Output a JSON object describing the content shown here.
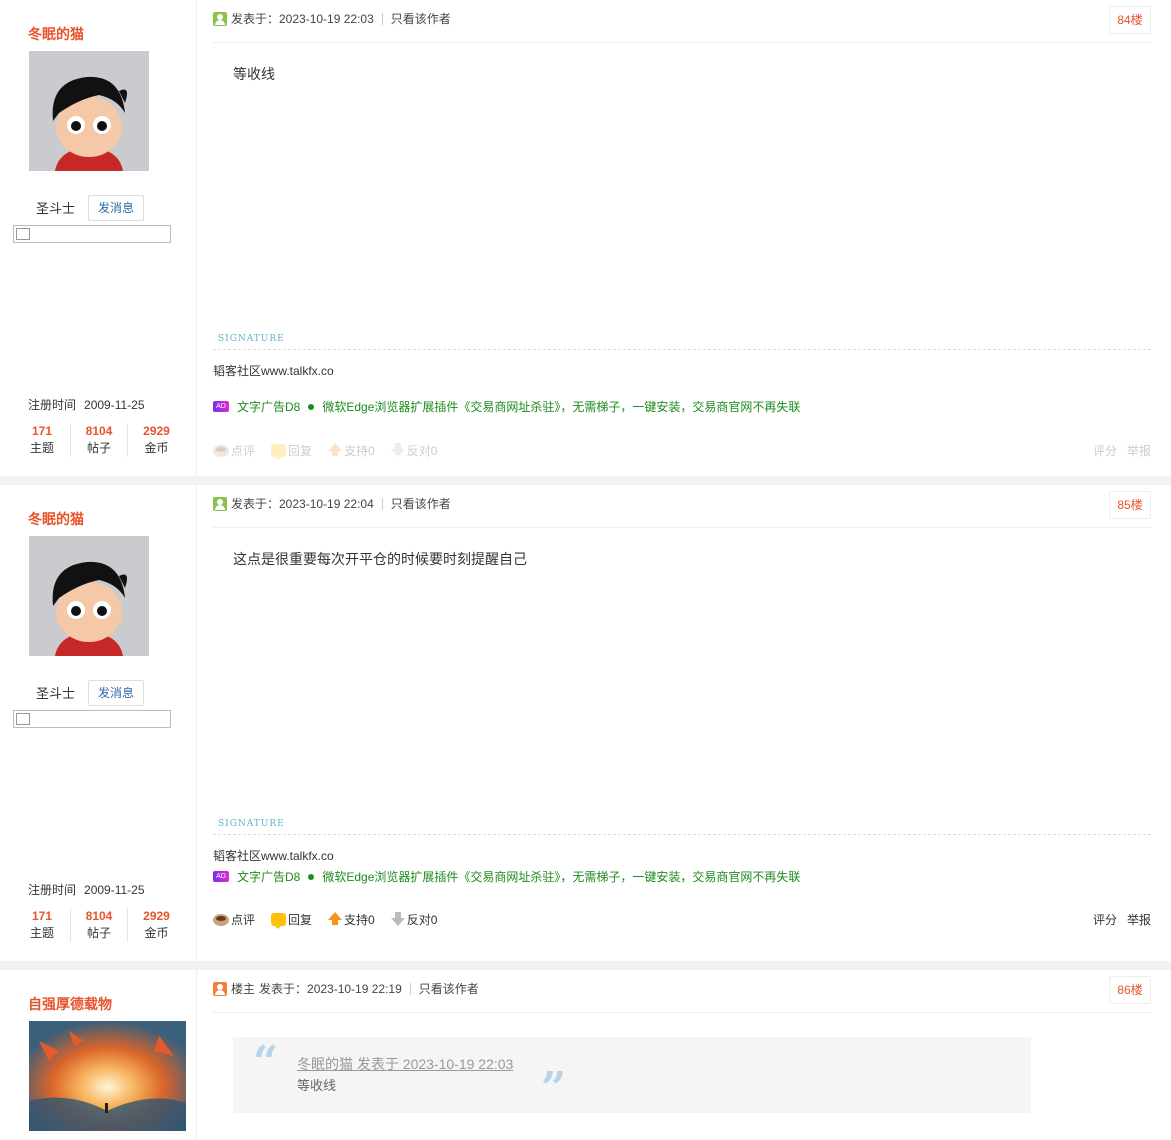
{
  "posts": [
    {
      "username": "冬眠的猫",
      "rank": "圣斗士",
      "message_btn": "发消息",
      "reg_label": "注册时间",
      "reg_date": "2009-11-25",
      "stats": [
        {
          "value": "171",
          "label": "主题"
        },
        {
          "value": "8104",
          "label": "帖子"
        },
        {
          "value": "2929",
          "label": "金币"
        }
      ],
      "posted": "发表于：2023-10-19 22:03",
      "author_only": "只看该作者",
      "floor": "84楼",
      "content": "等收线",
      "signature_label": "SIGNATURE",
      "signature": "韬客社区www.talkfx.co",
      "ad_title": "文字广告D8",
      "ad_text": "微软Edge浏览器扩展插件《交易商网址杀驻》，无需梯子，一键安装，交易商官网不再失联",
      "actions": {
        "comment": "点评",
        "reply": "回复",
        "support": "支持0",
        "oppose": "反对0",
        "rate": "评分",
        "report": "举报"
      }
    },
    {
      "username": "冬眠的猫",
      "rank": "圣斗士",
      "message_btn": "发消息",
      "reg_label": "注册时间",
      "reg_date": "2009-11-25",
      "stats": [
        {
          "value": "171",
          "label": "主题"
        },
        {
          "value": "8104",
          "label": "帖子"
        },
        {
          "value": "2929",
          "label": "金币"
        }
      ],
      "posted": "发表于：2023-10-19 22:04",
      "author_only": "只看该作者",
      "floor": "85楼",
      "content": "这点是很重要每次开平仓的时候要时刻提醒自己",
      "signature_label": "SIGNATURE",
      "signature": "韬客社区www.talkfx.co",
      "ad_title": "文字广告D8",
      "ad_text": "微软Edge浏览器扩展插件《交易商网址杀驻》，无需梯子，一键安装，交易商官网不再失联",
      "actions": {
        "comment": "点评",
        "reply": "回复",
        "support": "支持0",
        "oppose": "反对0",
        "rate": "评分",
        "report": "举报"
      }
    },
    {
      "username": "自强厚德载物",
      "owner_tag": "楼主",
      "posted": "发表于：2023-10-19 22:19",
      "author_only": "只看该作者",
      "floor": "86楼",
      "quote_meta": "冬眠的猫 发表于 2023-10-19 22:03",
      "quote_text": "等收线"
    }
  ],
  "colors": {
    "accent": "#e8542d",
    "link": "#2b6aa6",
    "ad_green": "#1d8b1d"
  }
}
